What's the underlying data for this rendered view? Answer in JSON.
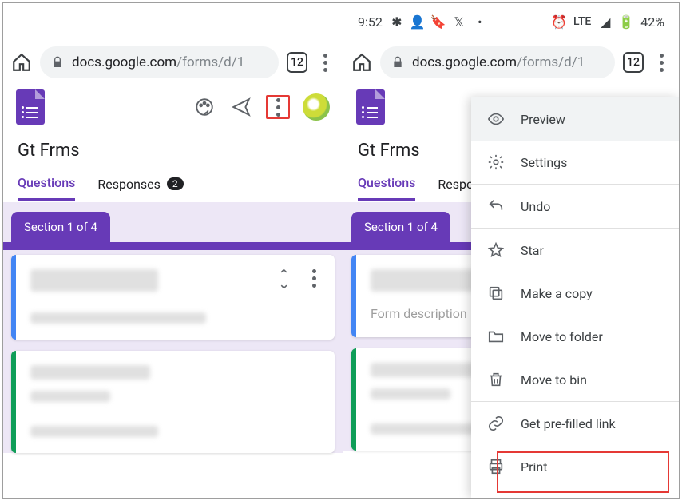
{
  "status": {
    "time": "9:52",
    "lte": "LTE",
    "battery": "42%"
  },
  "addrbar": {
    "host": "docs.google.com",
    "path": "/forms/d/1",
    "tab_count": "12"
  },
  "forms": {
    "doc_title": "Gt Frms",
    "tabs": {
      "questions": "Questions",
      "responses": "Responses",
      "responses_count": "2"
    },
    "section_label": "Section 1 of 4",
    "desc_placeholder": "Form description"
  },
  "menu": {
    "preview": "Preview",
    "settings": "Settings",
    "undo": "Undo",
    "star": "Star",
    "copy": "Make a copy",
    "move": "Move to folder",
    "bin": "Move to bin",
    "prefilled": "Get pre-filled link",
    "print": "Print"
  }
}
